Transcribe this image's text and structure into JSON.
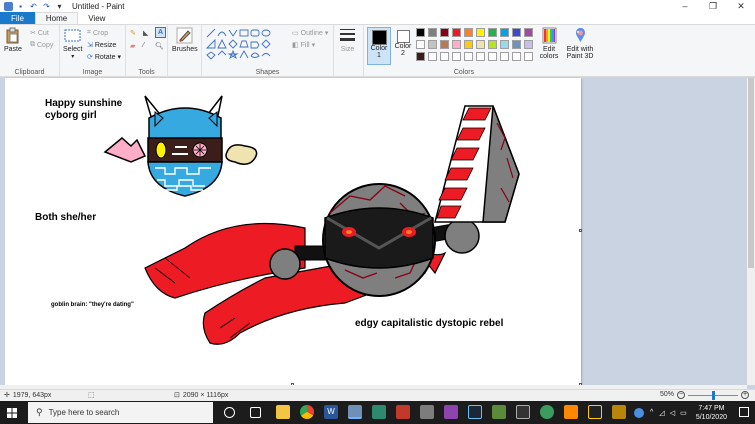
{
  "window": {
    "title": "Untitled - Paint"
  },
  "tabs": {
    "file": "File",
    "home": "Home",
    "view": "View"
  },
  "ribbon": {
    "clipboard": {
      "paste": "Paste",
      "cut": "Cut",
      "copy": "Copy",
      "label": "Clipboard"
    },
    "image": {
      "select": "Select",
      "crop": "Crop",
      "resize": "Resize",
      "rotate": "Rotate",
      "label": "Image"
    },
    "tools": {
      "label": "Tools",
      "brushes": "Brushes"
    },
    "shapes": {
      "outline": "Outline",
      "fill": "Fill",
      "label": "Shapes"
    },
    "size": {
      "label": "Size"
    },
    "colors": {
      "color1": "Color 1",
      "color2": "Color 2",
      "edit": "Edit colors",
      "paint3d": "Edit with Paint 3D",
      "label": "Colors",
      "color1_value": "#000000",
      "color2_value": "#ffffff",
      "palette_row1": [
        "#000000",
        "#7f7f7f",
        "#880015",
        "#ed1c24",
        "#ff7f27",
        "#fff200",
        "#22b14c",
        "#00a2e8",
        "#3f48cc",
        "#a349a4"
      ],
      "palette_row2": [
        "#ffffff",
        "#c3c3c3",
        "#b97a57",
        "#ffaec9",
        "#ffc90e",
        "#efe4b0",
        "#b5e61d",
        "#99d9ea",
        "#7092be",
        "#c8bfe7"
      ],
      "palette_row3": [
        "#3b1e1a",
        "#ffffff",
        "#ffffff",
        "#ffffff",
        "#ffffff",
        "#ffffff",
        "#ffffff",
        "#ffffff",
        "#ffffff",
        "#ffffff"
      ]
    }
  },
  "canvas_texts": {
    "sunshine_line1": "Happy sunshine",
    "sunshine_line2": "cyborg girl",
    "pronouns": "Both she/her",
    "goblin": "goblin brain: \"they're dating\"",
    "rebel": "edgy capitalistic dystopic rebel"
  },
  "status": {
    "cursor_pos": "1979, 643px",
    "image_size": "2090 × 1116px",
    "zoom": "50%",
    "zoom_fraction": 0.5
  },
  "taskbar": {
    "search_placeholder": "Type here to search",
    "time": "7:47 PM",
    "date": "5/10/2020"
  }
}
